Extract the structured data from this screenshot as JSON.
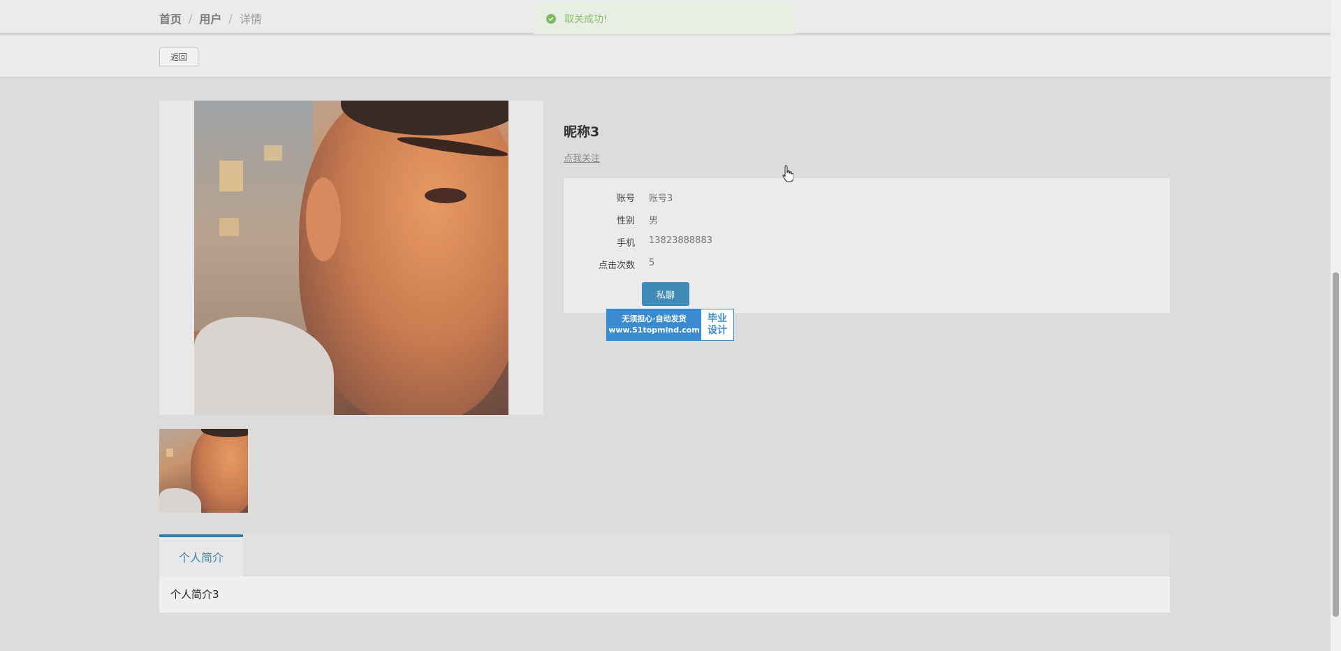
{
  "breadcrumb": {
    "home": "首页",
    "users": "用户",
    "current": "详情",
    "separator": "/"
  },
  "toast": {
    "message": "取关成功!",
    "icon": "check-circle-icon",
    "color": "#7dbb63"
  },
  "toolbar": {
    "back_label": "返回"
  },
  "user": {
    "nickname": "昵称3",
    "follow_link": "点我关注",
    "fields": [
      {
        "label": "账号",
        "value": "账号3"
      },
      {
        "label": "性别",
        "value": "男"
      },
      {
        "label": "手机",
        "value": "13823888883"
      },
      {
        "label": "点击次数",
        "value": "5"
      }
    ],
    "chat_label": "私聊"
  },
  "watermark": {
    "line1": "无须担心·自动发货",
    "line2": "www.51topmind.com",
    "right1": "毕业",
    "right2": "设计"
  },
  "tabs": {
    "items": [
      {
        "label": "个人简介"
      }
    ],
    "content": "个人简介3"
  },
  "colors": {
    "accent": "#3f8bb8",
    "tab_active": "#2f7fb0",
    "toast_text": "#89bf70"
  }
}
